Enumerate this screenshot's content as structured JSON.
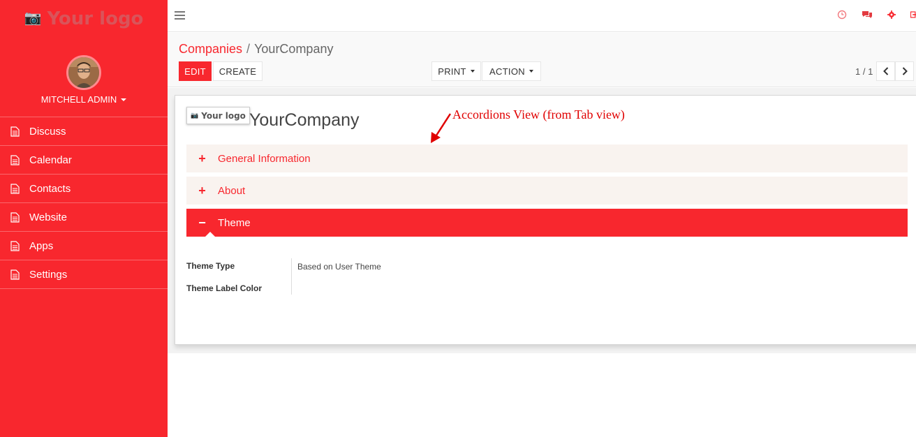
{
  "sidebar": {
    "logo_text": "Your logo",
    "user_name": "MITCHELL ADMIN",
    "items": [
      {
        "label": "Discuss"
      },
      {
        "label": "Calendar"
      },
      {
        "label": "Contacts"
      },
      {
        "label": "Website"
      },
      {
        "label": "Apps"
      },
      {
        "label": "Settings"
      }
    ]
  },
  "topbar": {
    "icons": [
      "menu-icon",
      "clock-icon",
      "chat-icon",
      "gear-icon",
      "logout-icon"
    ]
  },
  "control": {
    "breadcrumb_parent": "Companies",
    "breadcrumb_separator": "/",
    "breadcrumb_current": "YourCompany",
    "edit_label": "EDIT",
    "create_label": "CREATE",
    "print_label": "PRINT",
    "action_label": "ACTION",
    "pager_text": "1 / 1"
  },
  "form": {
    "logo_text": "Your logo",
    "company_name": "YourCompany",
    "annotation": "Accordions View (from Tab view)",
    "accordions": [
      {
        "sign": "+",
        "label": "General Information",
        "expanded": false
      },
      {
        "sign": "+",
        "label": "About",
        "expanded": false
      },
      {
        "sign": "−",
        "label": "Theme",
        "expanded": true
      }
    ],
    "theme_fields": {
      "theme_type_label": "Theme Type",
      "theme_type_value": "Based on User Theme",
      "theme_label_color_label": "Theme Label Color"
    }
  },
  "colors": {
    "accent": "#f8272e",
    "accordion_bg": "#f9f3ef",
    "annotation": "#e00000"
  }
}
